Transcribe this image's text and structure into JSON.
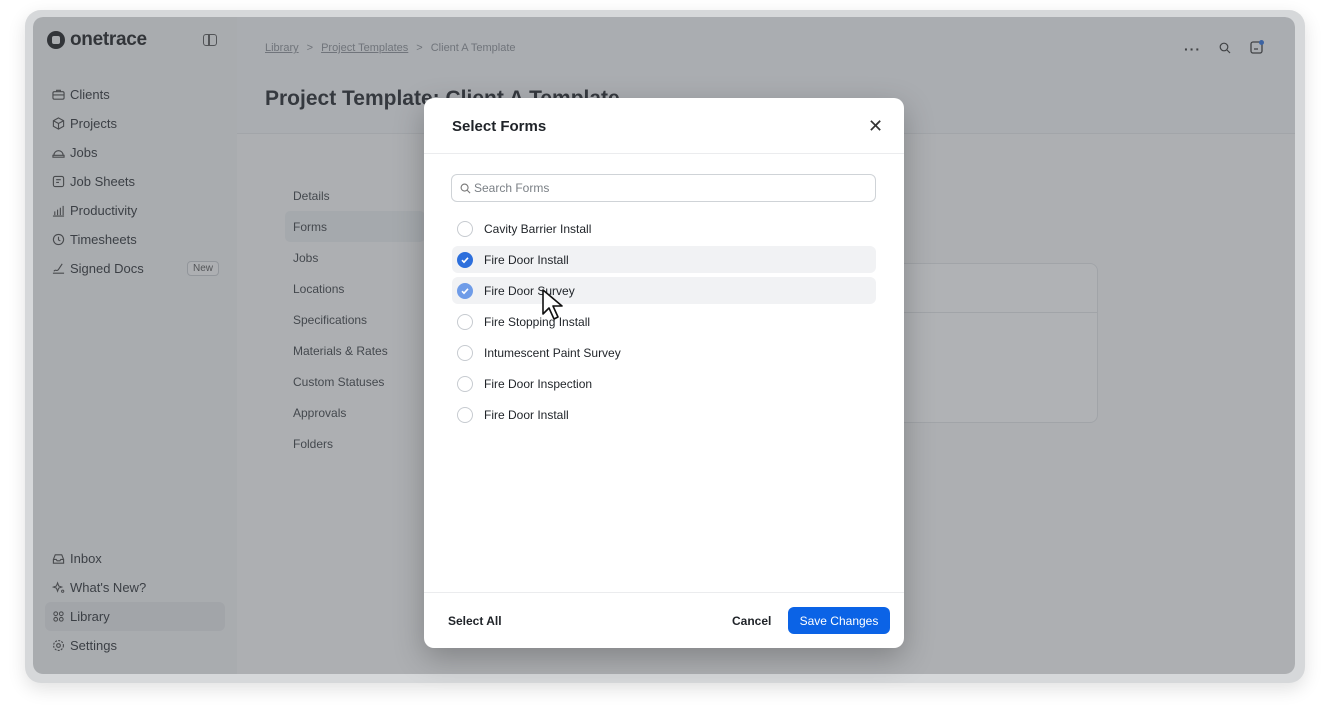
{
  "app": {
    "logo_text": "onetrace"
  },
  "sidebar": {
    "items": [
      {
        "label": "Clients",
        "icon": "briefcase-icon"
      },
      {
        "label": "Projects",
        "icon": "cube-icon"
      },
      {
        "label": "Jobs",
        "icon": "hardhat-icon"
      },
      {
        "label": "Job Sheets",
        "icon": "sheet-icon"
      },
      {
        "label": "Productivity",
        "icon": "chart-icon"
      },
      {
        "label": "Timesheets",
        "icon": "clock-icon"
      },
      {
        "label": "Signed Docs",
        "icon": "signature-icon",
        "badge": "New"
      }
    ],
    "bottom_items": [
      {
        "label": "Inbox",
        "icon": "inbox-icon"
      },
      {
        "label": "What's New?",
        "icon": "sparkle-icon"
      },
      {
        "label": "Library",
        "icon": "grid-icon"
      },
      {
        "label": "Settings",
        "icon": "gear-icon"
      }
    ]
  },
  "breadcrumb": {
    "items": [
      "Library",
      "Project Templates",
      "Client A Template"
    ],
    "separator": ">"
  },
  "page": {
    "title": "Project Template: Client A Template"
  },
  "subnav": {
    "items": [
      "Details",
      "Forms",
      "Jobs",
      "Locations",
      "Specifications",
      "Materials & Rates",
      "Custom Statuses",
      "Approvals",
      "Folders"
    ],
    "active": "Forms"
  },
  "modal": {
    "title": "Select Forms",
    "search_placeholder": "Search Forms",
    "forms": [
      {
        "label": "Cavity Barrier Install",
        "checked": false
      },
      {
        "label": "Fire Door Install",
        "checked": true
      },
      {
        "label": "Fire Door Survey",
        "checked": true
      },
      {
        "label": "Fire Stopping Install",
        "checked": false
      },
      {
        "label": "Intumescent Paint Survey",
        "checked": false
      },
      {
        "label": "Fire Door Inspection",
        "checked": false
      },
      {
        "label": "Fire Door Install",
        "checked": false
      }
    ],
    "select_all_label": "Select All",
    "cancel_label": "Cancel",
    "save_label": "Save Changes"
  },
  "colors": {
    "accent": "#0b63e6",
    "checked": "#2d6fdc"
  }
}
